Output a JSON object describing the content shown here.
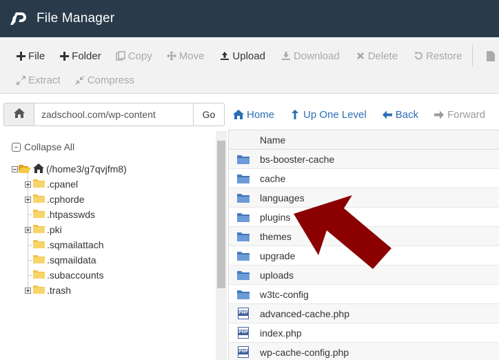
{
  "header": {
    "title": "File Manager"
  },
  "toolbar": {
    "row1": [
      {
        "label": "File",
        "icon": "plus-icon",
        "enabled": true
      },
      {
        "label": "Folder",
        "icon": "plus-icon",
        "enabled": true
      },
      {
        "label": "Copy",
        "icon": "copy-icon",
        "enabled": false
      },
      {
        "label": "Move",
        "icon": "move-icon",
        "enabled": false
      },
      {
        "label": "Upload",
        "icon": "upload-icon",
        "enabled": true
      },
      {
        "label": "Download",
        "icon": "download-icon",
        "enabled": false
      },
      {
        "label": "Delete",
        "icon": "delete-icon",
        "enabled": false
      },
      {
        "label": "Restore",
        "icon": "restore-icon",
        "enabled": false
      }
    ],
    "row2": [
      {
        "label": "Extract",
        "icon": "extract-icon",
        "enabled": false
      },
      {
        "label": "Compress",
        "icon": "compress-icon",
        "enabled": false
      }
    ]
  },
  "address": {
    "path": "zadschool.com/wp-content",
    "go_label": "Go"
  },
  "nav": {
    "home": "Home",
    "up": "Up One Level",
    "back": "Back",
    "forward": "Forward"
  },
  "tree": {
    "collapse_label": "Collapse All",
    "root": "(/home3/g7qvjfm8)",
    "children": [
      {
        "name": ".cpanel",
        "expandable": true
      },
      {
        "name": ".cphorde",
        "expandable": true
      },
      {
        "name": ".htpasswds",
        "expandable": false
      },
      {
        "name": ".pki",
        "expandable": true
      },
      {
        "name": ".sqmailattach",
        "expandable": false
      },
      {
        "name": ".sqmaildata",
        "expandable": false
      },
      {
        "name": ".subaccounts",
        "expandable": false
      },
      {
        "name": ".trash",
        "expandable": true
      }
    ]
  },
  "list": {
    "column_name": "Name",
    "items": [
      {
        "name": "bs-booster-cache",
        "type": "folder"
      },
      {
        "name": "cache",
        "type": "folder"
      },
      {
        "name": "languages",
        "type": "folder"
      },
      {
        "name": "plugins",
        "type": "folder"
      },
      {
        "name": "themes",
        "type": "folder"
      },
      {
        "name": "upgrade",
        "type": "folder"
      },
      {
        "name": "uploads",
        "type": "folder"
      },
      {
        "name": "w3tc-config",
        "type": "folder"
      },
      {
        "name": "advanced-cache.php",
        "type": "php"
      },
      {
        "name": "index.php",
        "type": "php"
      },
      {
        "name": "wp-cache-config.php",
        "type": "php"
      }
    ]
  },
  "colors": {
    "header_bg": "#293a4a",
    "link_blue": "#2a6fb5",
    "arrow_red": "#8b0000",
    "folder_blue": "#5b8fd1"
  }
}
